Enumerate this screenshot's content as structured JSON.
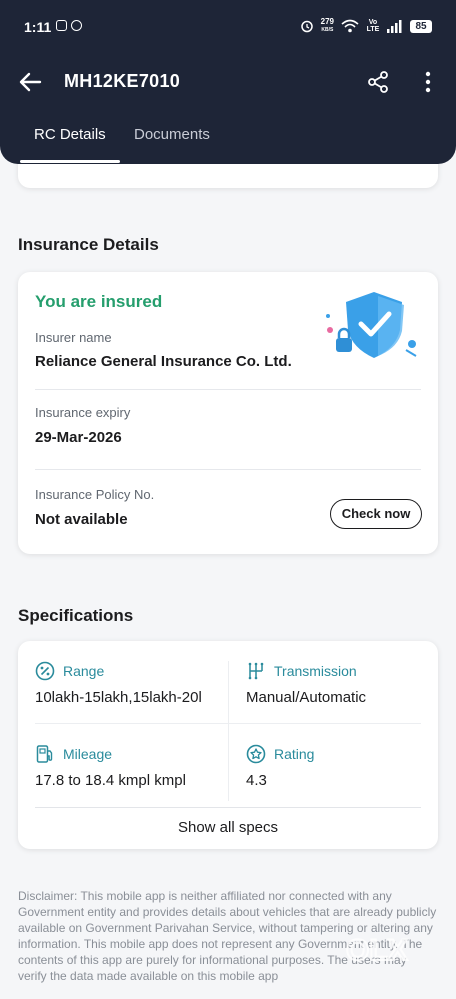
{
  "status_bar": {
    "time": "1:11",
    "net_speed": "279",
    "net_unit": "KB/S",
    "volte": "Vo LTE",
    "battery": "85"
  },
  "app_bar": {
    "title": "MH12KE7010"
  },
  "tabs": [
    {
      "label": "RC Details",
      "active": true
    },
    {
      "label": "Documents",
      "active": false
    }
  ],
  "insurance": {
    "section_title": "Insurance Details",
    "status": "You are insured",
    "insurer_label": "Insurer name",
    "insurer_value": "Reliance General Insurance Co. Ltd.",
    "expiry_label": "Insurance expiry",
    "expiry_value": "29-Mar-2026",
    "policy_label": "Insurance Policy No.",
    "policy_value": "Not available",
    "check_button": "Check now"
  },
  "specifications": {
    "section_title": "Specifications",
    "items": [
      {
        "label": "Range",
        "value": "10lakh-15lakh,15lakh-20l",
        "icon": "percent-icon"
      },
      {
        "label": "Transmission",
        "value": "Manual/Automatic",
        "icon": "gearbox-icon"
      },
      {
        "label": "Mileage",
        "value": "17.8 to 18.4 kmpl kmpl",
        "icon": "fuel-pump-icon"
      },
      {
        "label": "Rating",
        "value": "4.3",
        "icon": "star-badge-icon"
      }
    ],
    "show_all": "Show all specs"
  },
  "disclaimer": "Disclaimer: This mobile app is neither affiliated nor connected with any Government entity and provides details about vehicles that are already publicly available on Government Parivahan Service, without tampering or altering any information. This mobile app does not represent any Government entity. The contents of this app are purely for informational purposes. The users may verify the data made available on this mobile app",
  "watermark": "OLX",
  "colors": {
    "header_bg": "#1e2537",
    "insured_green": "#259e6d",
    "spec_label_teal": "#2a8b9c",
    "page_bg": "#f5f6f8"
  }
}
